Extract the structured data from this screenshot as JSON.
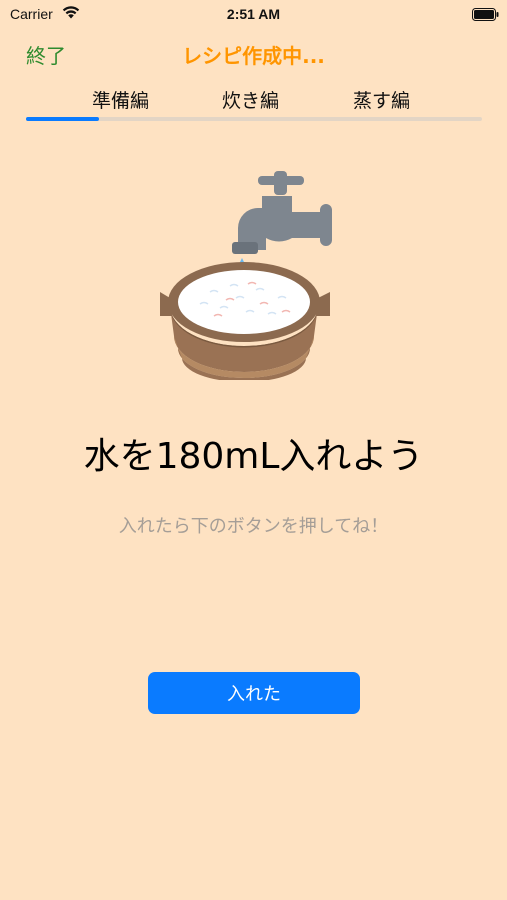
{
  "status_bar": {
    "carrier": "Carrier",
    "time": "2:51 AM",
    "wifi_icon": "wifi-icon",
    "battery_icon": "battery-icon"
  },
  "nav": {
    "left_button": "終了",
    "title": "レシピ作成中...",
    "left_color": "#2E8B2E",
    "title_color": "#FF9500"
  },
  "tabs": [
    {
      "label": "準備編"
    },
    {
      "label": "炊き編"
    },
    {
      "label": "蒸す編"
    }
  ],
  "progress": {
    "value": 0.16,
    "fill_color": "#0A7BFF"
  },
  "illustration": {
    "icon": "faucet-pouring-water-into-rice-pot-icon"
  },
  "content": {
    "headline": "水を180mL入れよう",
    "subtext": "入れたら下のボタンを押してね！"
  },
  "action": {
    "button_label": "入れた",
    "color": "#0A7BFF"
  },
  "background_color": "#FEE2C2"
}
